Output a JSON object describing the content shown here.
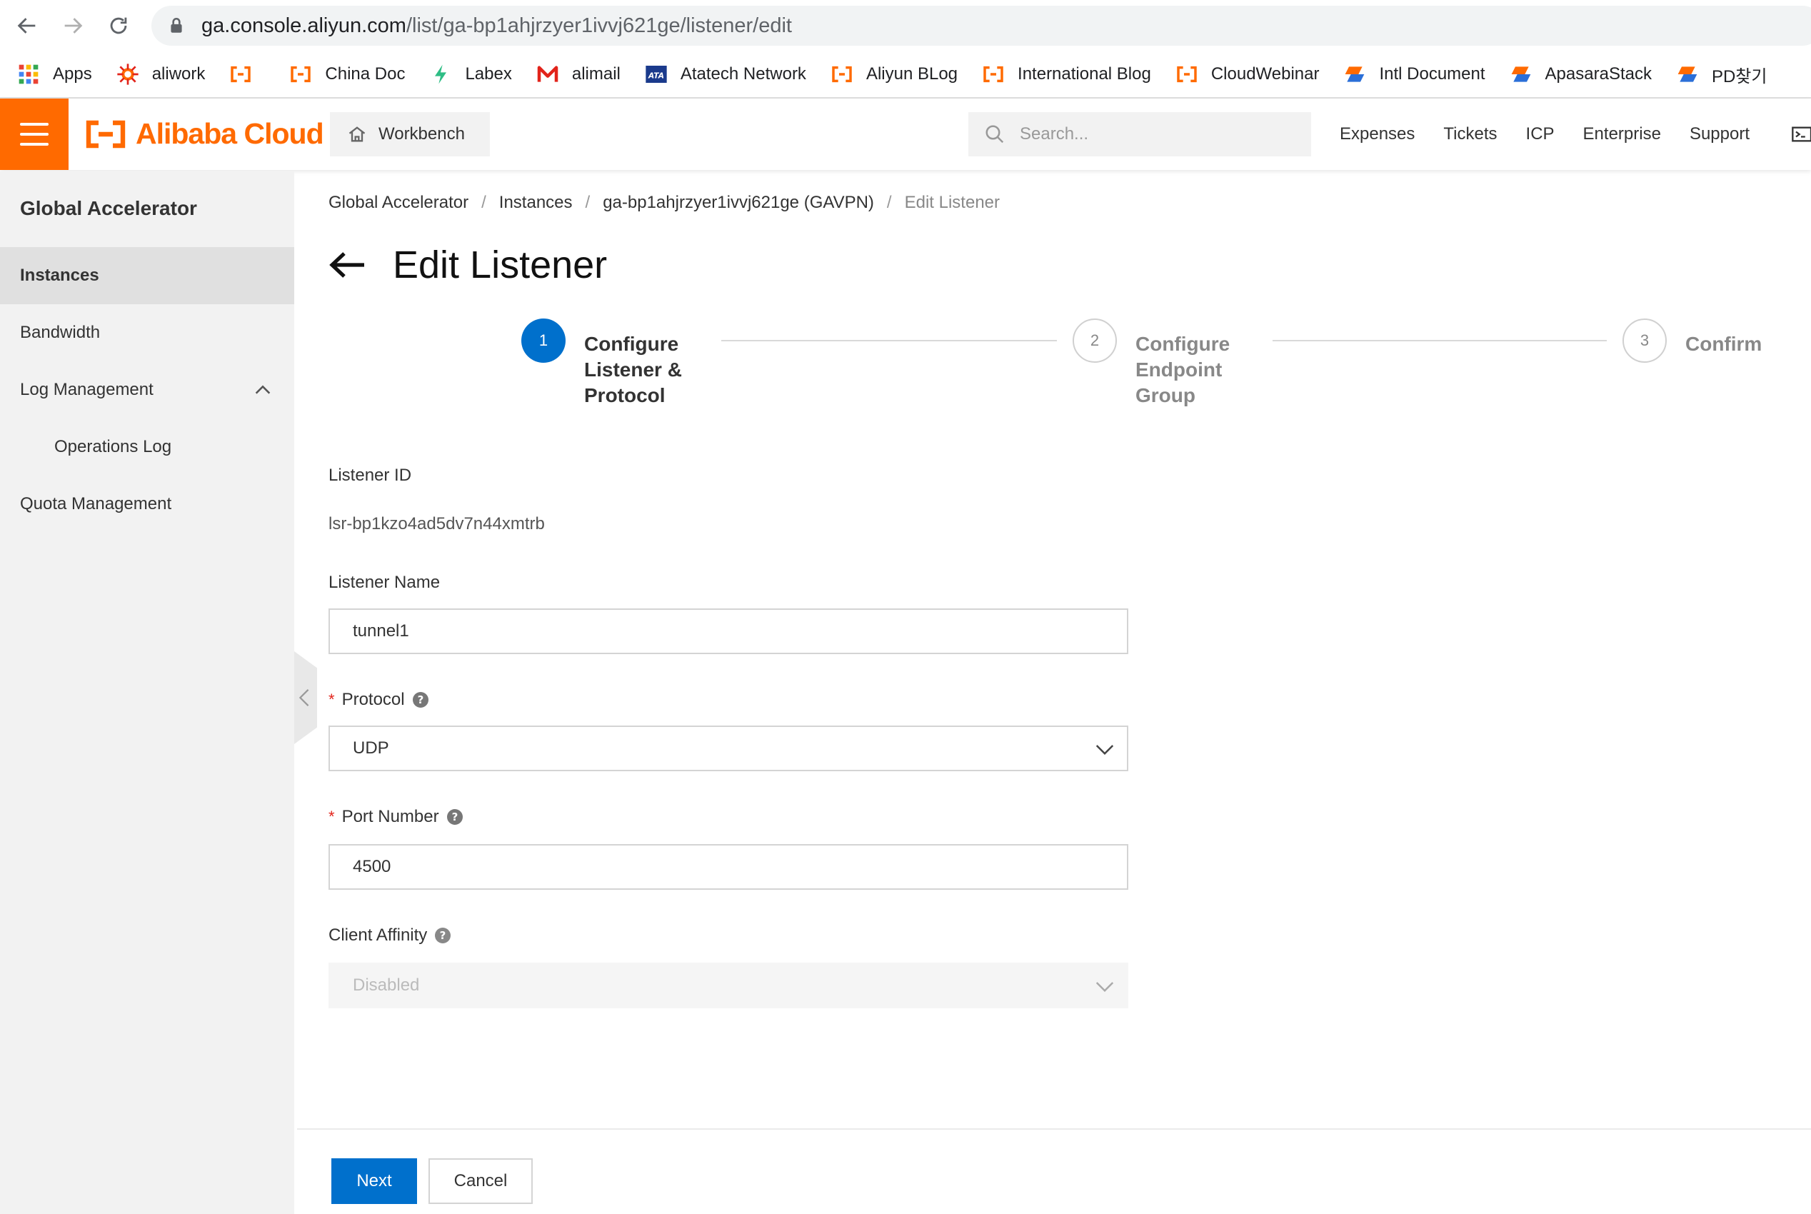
{
  "browser": {
    "url_host": "ga.console.aliyun.com",
    "url_path": "/list/ga-bp1ahjrzyer1ivvj621ge/listener/edit",
    "bookmarks": [
      {
        "label": "Apps",
        "icon": "apps-grid-icon"
      },
      {
        "label": "aliwork",
        "icon": "aliwork-icon"
      },
      {
        "label": "",
        "icon": "alibaba-cloud-bracket-icon"
      },
      {
        "label": "China Doc",
        "icon": "alibaba-cloud-bracket-icon"
      },
      {
        "label": "Labex",
        "icon": "labex-leaf-icon"
      },
      {
        "label": "alimail",
        "icon": "alimail-m-icon"
      },
      {
        "label": "Atatech Network",
        "icon": "ata-icon"
      },
      {
        "label": "Aliyun BLog",
        "icon": "alibaba-cloud-bracket-icon"
      },
      {
        "label": "International Blog",
        "icon": "alibaba-cloud-bracket-icon"
      },
      {
        "label": "CloudWebinar",
        "icon": "alibaba-cloud-bracket-icon"
      },
      {
        "label": "Intl Document",
        "icon": "stack-icon"
      },
      {
        "label": "ApasaraStack",
        "icon": "stack-icon"
      },
      {
        "label": "PD찾기",
        "icon": "stack-icon"
      }
    ]
  },
  "topbar": {
    "brand": "Alibaba Cloud",
    "workbench": "Workbench",
    "search_placeholder": "Search...",
    "links": [
      "Expenses",
      "Tickets",
      "ICP",
      "Enterprise",
      "Support"
    ],
    "accent_color": "#ff6a00"
  },
  "sidebar": {
    "title": "Global Accelerator",
    "items": [
      {
        "label": "Instances",
        "active": true
      },
      {
        "label": "Bandwidth"
      },
      {
        "label": "Log Management",
        "expanded": true
      },
      {
        "label": "Operations Log",
        "sub": true
      },
      {
        "label": "Quota Management"
      }
    ]
  },
  "breadcrumb": [
    "Global Accelerator",
    "Instances",
    "ga-bp1ahjrzyer1ivvj621ge (GAVPN)",
    "Edit Listener"
  ],
  "page": {
    "title": "Edit Listener"
  },
  "steps": [
    {
      "number": "1",
      "line1": "Configure",
      "line2": "Listener &",
      "line3": "Protocol",
      "state": "active"
    },
    {
      "number": "2",
      "line1": "Configure",
      "line2": "Endpoint",
      "line3": "Group",
      "state": "todo"
    },
    {
      "number": "3",
      "line1": "Confirm",
      "line2": "",
      "line3": "",
      "state": "todo"
    }
  ],
  "form": {
    "listener_id_label": "Listener ID",
    "listener_id_value": "lsr-bp1kzo4ad5dv7n44xmtrb",
    "listener_name_label": "Listener Name",
    "listener_name_value": "tunnel1",
    "protocol_label": "Protocol",
    "protocol_value": "UDP",
    "port_label": "Port Number",
    "port_value": "4500",
    "affinity_label": "Client Affinity",
    "affinity_value": "Disabled"
  },
  "footer": {
    "next": "Next",
    "cancel": "Cancel",
    "primary_color": "#0070cc"
  }
}
